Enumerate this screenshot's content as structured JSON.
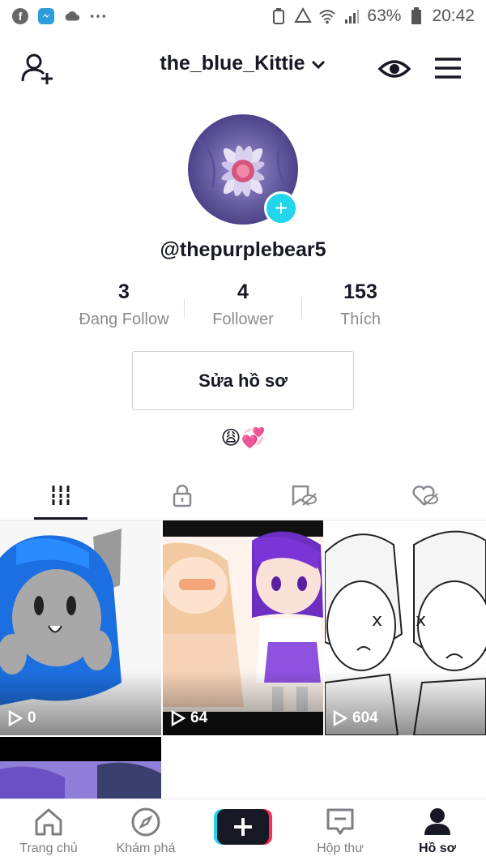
{
  "status_bar": {
    "notification_icons": [
      "facebook-icon",
      "messenger-icon",
      "cloud-icon",
      "more-dots-icon"
    ],
    "battery_percent": "63%",
    "time": "20:42"
  },
  "header": {
    "username": "the_blue_Kittie"
  },
  "profile": {
    "handle": "@thepurplebear5",
    "stats": [
      {
        "value": "3",
        "label": "Đang Follow"
      },
      {
        "value": "4",
        "label": "Follower"
      },
      {
        "value": "153",
        "label": "Thích"
      }
    ],
    "edit_label": "Sửa hồ sơ",
    "bio": "😩💞"
  },
  "tabs": [
    "videos-grid-icon",
    "private-lock-icon",
    "saved-hidden-icon",
    "liked-hidden-icon"
  ],
  "videos": [
    {
      "views": "0"
    },
    {
      "views": "64"
    },
    {
      "views": "604"
    },
    {
      "views": ""
    }
  ],
  "bottom_nav": [
    {
      "label": "Trang chủ",
      "icon": "home-icon"
    },
    {
      "label": "Khám phá",
      "icon": "compass-icon"
    },
    {
      "label": "",
      "icon": "plus-icon"
    },
    {
      "label": "Hộp thư",
      "icon": "inbox-icon"
    },
    {
      "label": "Hồ sơ",
      "icon": "profile-icon"
    }
  ],
  "colors": {
    "accent_cyan": "#20d5ec",
    "accent_pink": "#fe2c55",
    "text_primary": "#161823",
    "text_secondary": "#8a8b91"
  }
}
